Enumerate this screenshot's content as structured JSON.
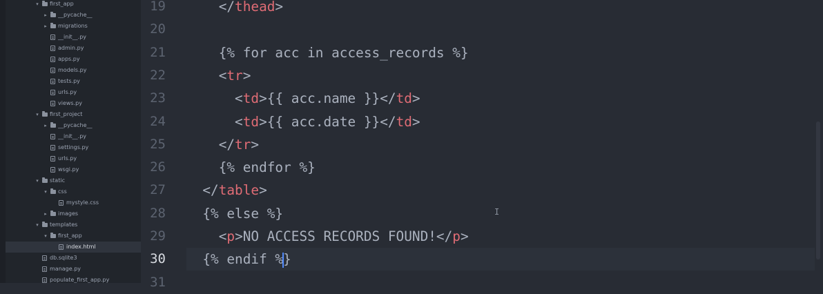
{
  "sidebar": {
    "items": [
      {
        "label": "first_app",
        "type": "folder",
        "expanded": true,
        "depth": 2
      },
      {
        "label": "__pycache__",
        "type": "folder",
        "expanded": false,
        "depth": 3
      },
      {
        "label": "migrations",
        "type": "folder",
        "expanded": false,
        "depth": 3
      },
      {
        "label": "__init__.py",
        "type": "file",
        "depth": 3
      },
      {
        "label": "admin.py",
        "type": "file",
        "depth": 3
      },
      {
        "label": "apps.py",
        "type": "file",
        "depth": 3
      },
      {
        "label": "models.py",
        "type": "file",
        "depth": 3
      },
      {
        "label": "tests.py",
        "type": "file",
        "depth": 3
      },
      {
        "label": "urls.py",
        "type": "file",
        "depth": 3
      },
      {
        "label": "views.py",
        "type": "file",
        "depth": 3
      },
      {
        "label": "first_project",
        "type": "folder",
        "expanded": true,
        "depth": 2
      },
      {
        "label": "__pycache__",
        "type": "folder",
        "expanded": false,
        "depth": 3
      },
      {
        "label": "__init__.py",
        "type": "file",
        "depth": 3
      },
      {
        "label": "settings.py",
        "type": "file",
        "depth": 3
      },
      {
        "label": "urls.py",
        "type": "file",
        "depth": 3
      },
      {
        "label": "wsgi.py",
        "type": "file",
        "depth": 3
      },
      {
        "label": "static",
        "type": "folder",
        "expanded": true,
        "depth": 2
      },
      {
        "label": "css",
        "type": "folder",
        "expanded": true,
        "depth": 3
      },
      {
        "label": "mystyle.css",
        "type": "file",
        "depth": 4
      },
      {
        "label": "images",
        "type": "folder",
        "expanded": false,
        "depth": 3
      },
      {
        "label": "templates",
        "type": "folder",
        "expanded": true,
        "depth": 2
      },
      {
        "label": "first_app",
        "type": "folder",
        "expanded": true,
        "depth": 3
      },
      {
        "label": "index.html",
        "type": "file",
        "depth": 4,
        "selected": true
      },
      {
        "label": "db.sqlite3",
        "type": "file",
        "depth": 2
      },
      {
        "label": "manage.py",
        "type": "file",
        "depth": 2
      },
      {
        "label": "populate_first_app.py",
        "type": "file",
        "depth": 2
      }
    ]
  },
  "editor": {
    "active_line": "30",
    "lines": [
      {
        "no": "19",
        "segments": [
          {
            "t": "    </",
            "c": "text"
          },
          {
            "t": "thead",
            "c": "tag"
          },
          {
            "t": ">",
            "c": "text"
          }
        ]
      },
      {
        "no": "20",
        "segments": []
      },
      {
        "no": "21",
        "segments": [
          {
            "t": "    {% for acc in access_records %}",
            "c": "text"
          }
        ]
      },
      {
        "no": "22",
        "segments": [
          {
            "t": "    <",
            "c": "text"
          },
          {
            "t": "tr",
            "c": "tag"
          },
          {
            "t": ">",
            "c": "text"
          }
        ]
      },
      {
        "no": "23",
        "segments": [
          {
            "t": "      <",
            "c": "text"
          },
          {
            "t": "td",
            "c": "tag"
          },
          {
            "t": ">{{ acc.name }}</",
            "c": "text"
          },
          {
            "t": "td",
            "c": "tag"
          },
          {
            "t": ">",
            "c": "text"
          }
        ]
      },
      {
        "no": "24",
        "segments": [
          {
            "t": "      <",
            "c": "text"
          },
          {
            "t": "td",
            "c": "tag"
          },
          {
            "t": ">{{ acc.date }}</",
            "c": "text"
          },
          {
            "t": "td",
            "c": "tag"
          },
          {
            "t": ">",
            "c": "text"
          }
        ]
      },
      {
        "no": "25",
        "segments": [
          {
            "t": "    </",
            "c": "text"
          },
          {
            "t": "tr",
            "c": "tag"
          },
          {
            "t": ">",
            "c": "text"
          }
        ]
      },
      {
        "no": "26",
        "segments": [
          {
            "t": "    {% endfor %}",
            "c": "text"
          }
        ]
      },
      {
        "no": "27",
        "segments": [
          {
            "t": "  </",
            "c": "text"
          },
          {
            "t": "table",
            "c": "tag"
          },
          {
            "t": ">",
            "c": "text"
          }
        ]
      },
      {
        "no": "28",
        "segments": [
          {
            "t": "  {% else %}",
            "c": "text"
          }
        ]
      },
      {
        "no": "29",
        "segments": [
          {
            "t": "    <",
            "c": "text"
          },
          {
            "t": "p",
            "c": "tag"
          },
          {
            "t": ">NO ACCESS RECORDS FOUND!</",
            "c": "text"
          },
          {
            "t": "p",
            "c": "tag"
          },
          {
            "t": ">",
            "c": "text"
          }
        ]
      },
      {
        "no": "30",
        "segments": [
          {
            "t": "  {% endif %",
            "c": "text"
          },
          {
            "t": "|",
            "c": "cursor"
          },
          {
            "t": "}",
            "c": "text"
          }
        ]
      },
      {
        "no": "31",
        "segments": []
      }
    ]
  },
  "colors": {
    "tag": "#e06c75",
    "text": "#abb2bf",
    "background": "#282c34",
    "sidebar": "#21252b"
  }
}
